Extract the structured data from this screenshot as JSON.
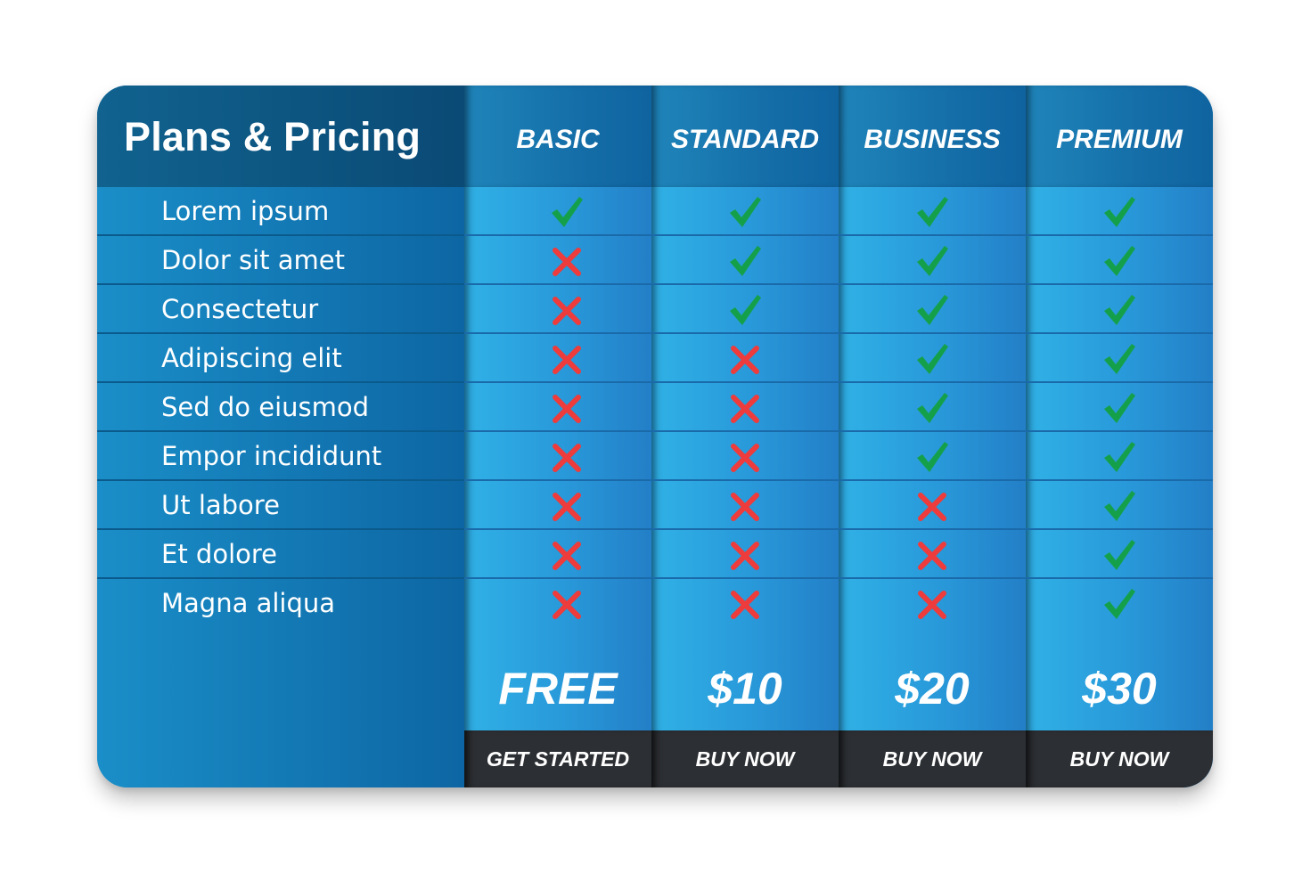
{
  "title": "Plans & Pricing",
  "colors": {
    "check": "#14a04a",
    "cross": "#ee3b3b",
    "header_dark": "#0a4a75",
    "button_bg": "#2c2f33"
  },
  "features": [
    "Lorem ipsum",
    "Dolor sit amet",
    "Consectetur",
    "Adipiscing elit",
    "Sed do eiusmod",
    "Empor incididunt",
    "Ut labore",
    "Et dolore",
    "Magna aliqua"
  ],
  "plans": [
    {
      "name": "BASIC",
      "price": "FREE",
      "button": "GET STARTED",
      "included": [
        true,
        false,
        false,
        false,
        false,
        false,
        false,
        false,
        false
      ]
    },
    {
      "name": "STANDARD",
      "price": "$10",
      "button": "BUY NOW",
      "included": [
        true,
        true,
        true,
        false,
        false,
        false,
        false,
        false,
        false
      ]
    },
    {
      "name": "BUSINESS",
      "price": "$20",
      "button": "BUY NOW",
      "included": [
        true,
        true,
        true,
        true,
        true,
        true,
        false,
        false,
        false
      ]
    },
    {
      "name": "PREMIUM",
      "price": "$30",
      "button": "BUY NOW",
      "included": [
        true,
        true,
        true,
        true,
        true,
        true,
        true,
        true,
        true
      ]
    }
  ]
}
